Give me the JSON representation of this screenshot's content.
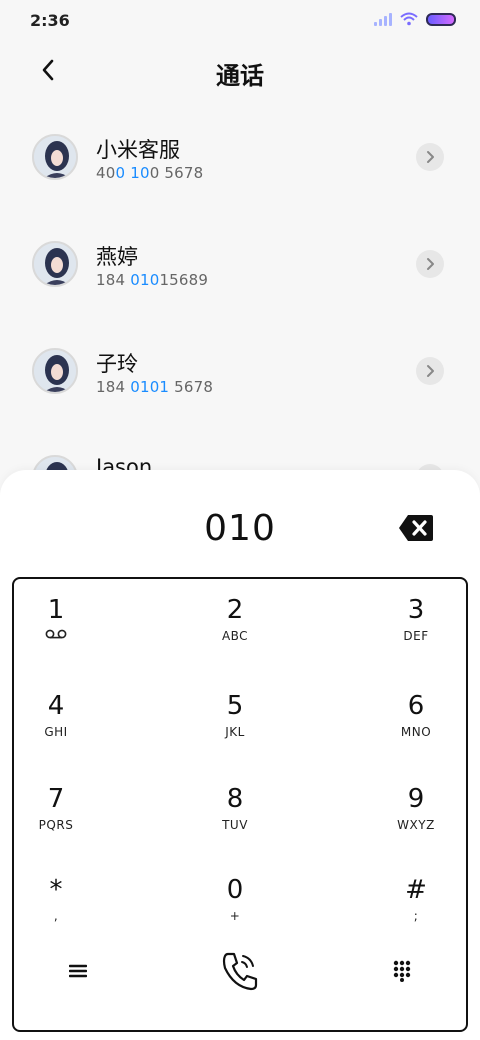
{
  "status_bar": {
    "time": "2:36"
  },
  "header": {
    "title": "通话"
  },
  "contacts": [
    {
      "name": "小米客服",
      "number_parts": [
        "40",
        "0 10",
        "0 5678"
      ]
    },
    {
      "name": "燕婷",
      "number_parts": [
        "184 ",
        "010",
        "15689"
      ]
    },
    {
      "name": "子玲",
      "number_parts": [
        "184 ",
        "0101",
        " 5678"
      ]
    },
    {
      "name": "Jason",
      "number_parts": [
        "",
        "",
        ""
      ]
    }
  ],
  "dialer": {
    "dialed": "010",
    "keys": [
      {
        "digit": "1",
        "letters": ""
      },
      {
        "digit": "2",
        "letters": "ABC"
      },
      {
        "digit": "3",
        "letters": "DEF"
      },
      {
        "digit": "4",
        "letters": "GHI"
      },
      {
        "digit": "5",
        "letters": "JKL"
      },
      {
        "digit": "6",
        "letters": "MNO"
      },
      {
        "digit": "7",
        "letters": "PQRS"
      },
      {
        "digit": "8",
        "letters": "TUV"
      },
      {
        "digit": "9",
        "letters": "WXYZ"
      },
      {
        "digit": "*",
        "letters": ","
      },
      {
        "digit": "0",
        "letters": "+"
      },
      {
        "digit": "#",
        "letters": ";"
      }
    ]
  },
  "icons": {
    "back": "chevron-left-icon",
    "detail": "chevron-right-icon",
    "backspace": "backspace-icon",
    "voicemail": "voicemail-icon",
    "menu": "menu-icon",
    "call": "phone-call-icon",
    "keypad": "dialpad-icon"
  },
  "colors": {
    "highlight": "#1a8cff",
    "background": "#f7f7f7"
  }
}
